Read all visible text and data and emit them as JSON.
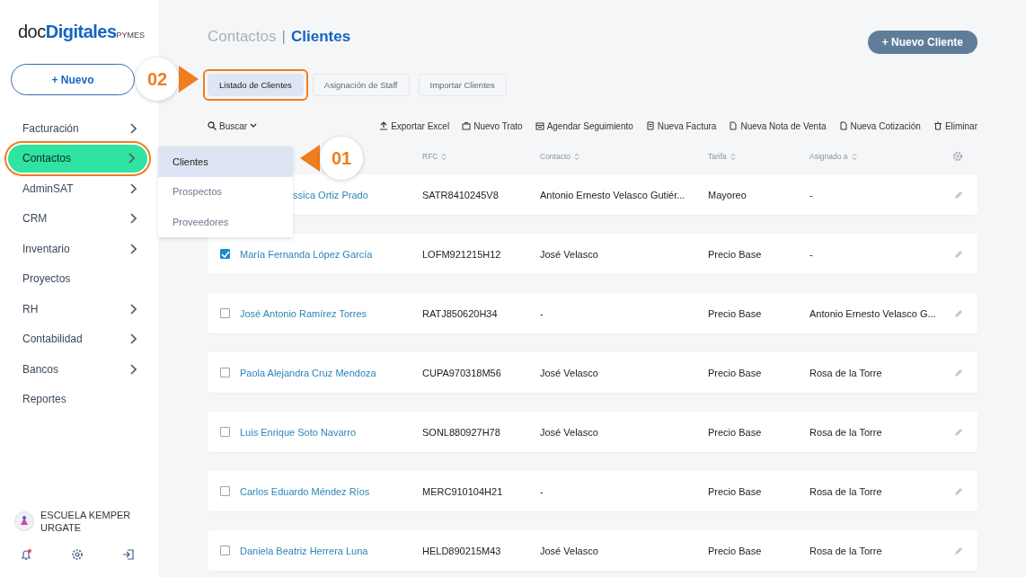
{
  "sidebar": {
    "logo": {
      "prefix": "doc",
      "brand": "Digitales",
      "suffix": "PYMES"
    },
    "new_button": {
      "label": "+ Nuevo"
    },
    "items": [
      {
        "label": "Facturación",
        "has_submenu": true,
        "selected": false,
        "highlighted": false
      },
      {
        "label": "Contactos",
        "has_submenu": true,
        "selected": true,
        "highlighted": true
      },
      {
        "label": "AdminSAT",
        "has_submenu": true,
        "selected": false,
        "highlighted": false
      },
      {
        "label": "CRM",
        "has_submenu": true,
        "selected": false,
        "highlighted": false
      },
      {
        "label": "Inventario",
        "has_submenu": true,
        "selected": false,
        "highlighted": false
      },
      {
        "label": "Proyectos",
        "has_submenu": false,
        "selected": false,
        "highlighted": false
      },
      {
        "label": "RH",
        "has_submenu": true,
        "selected": false,
        "highlighted": false
      },
      {
        "label": "Contabilidad",
        "has_submenu": true,
        "selected": false,
        "highlighted": false
      },
      {
        "label": "Bancos",
        "has_submenu": true,
        "selected": false,
        "highlighted": false
      },
      {
        "label": "Reportes",
        "has_submenu": false,
        "selected": false,
        "highlighted": false
      }
    ],
    "account": {
      "name": "ESCUELA KEMPER URGATE"
    },
    "notifications": {
      "unread": true
    }
  },
  "submenu": [
    {
      "label": "Clientes",
      "selected": true
    },
    {
      "label": "Prospectos",
      "selected": false
    },
    {
      "label": "Proveedores",
      "selected": false
    }
  ],
  "breadcrumb": {
    "parent": "Contactos",
    "separator": "|",
    "current": "Clientes"
  },
  "primary_button": {
    "label": "+ Nuevo Cliente"
  },
  "tabs": [
    {
      "label": "Listado de Clientes",
      "selected": true,
      "highlighted": true
    },
    {
      "label": "Asignación de Staff",
      "selected": false,
      "highlighted": false
    },
    {
      "label": "Importar Clientes",
      "selected": false,
      "highlighted": false
    }
  ],
  "search": {
    "label": "Buscar"
  },
  "actions": [
    {
      "label": "Exportar Excel",
      "kind": "upload"
    },
    {
      "label": "Nuevo Trato",
      "kind": "briefcase"
    },
    {
      "label": "Agendar Seguimiento",
      "kind": "calendar"
    },
    {
      "label": "Nueva Factura",
      "kind": "receipt"
    },
    {
      "label": "Nueva Nota de Venta",
      "kind": "document"
    },
    {
      "label": "Nueva Cotización",
      "kind": "document"
    },
    {
      "label": "Eliminar",
      "kind": "trash"
    }
  ],
  "table": {
    "columns": [
      "RFC",
      "Contacto",
      "Tarifa",
      "Asignado a"
    ],
    "rows": [
      {
        "name": "ssica Ortiz Prado",
        "covered": true,
        "rfc": "SATR8410245V8",
        "contact": "Antonio Ernesto Velasco Gutiér...",
        "tarifa": "Mayoreo",
        "assigned": "-"
      },
      {
        "name": "María Fernanda López García",
        "checked": true,
        "rfc": "LOFM921215H12",
        "contact": "José Velasco",
        "tarifa": "Precio Base",
        "assigned": "-"
      },
      {
        "name": "José Antonio Ramírez Torres",
        "checked": false,
        "rfc": "RATJ850620H34",
        "contact": "-",
        "tarifa": "Precio Base",
        "assigned": "Antonio Ernesto Velasco G..."
      },
      {
        "name": "Paola Alejandra Cruz Mendoza",
        "checked": false,
        "rfc": "CUPA970318M56",
        "contact": "José Velasco",
        "tarifa": "Precio Base",
        "assigned": "Rosa de la Torre"
      },
      {
        "name": "Luis Enrique Soto Navarro",
        "checked": false,
        "rfc": "SONL880927H78",
        "contact": "José Velasco",
        "tarifa": "Precio Base",
        "assigned": "Rosa de la Torre"
      },
      {
        "name": "Carlos Eduardo Méndez Ríos",
        "checked": false,
        "rfc": "MERC910104H21",
        "contact": "-",
        "tarifa": "Precio Base",
        "assigned": "Rosa de la Torre"
      },
      {
        "name": "Daniela Beatriz Herrera Luna",
        "checked": false,
        "rfc": "HELD890215M43",
        "contact": "José Velasco",
        "tarifa": "Precio Base",
        "assigned": "Rosa de la Torre"
      }
    ]
  },
  "callouts": [
    {
      "label": "02",
      "kind": "right"
    },
    {
      "label": "01",
      "kind": "left"
    }
  ]
}
